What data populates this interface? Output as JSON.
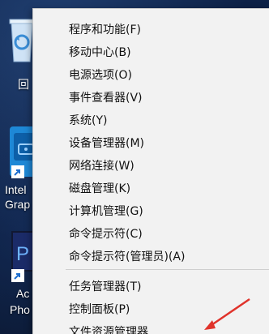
{
  "desktop": {
    "icons": [
      {
        "name": "recycle-bin",
        "label": "回"
      },
      {
        "name": "intel-graphics",
        "label_lines": [
          "Intel",
          "Grap"
        ]
      },
      {
        "name": "adobe-photoshop",
        "label_lines": [
          "Ac",
          "Pho"
        ]
      }
    ]
  },
  "context_menu": {
    "items": [
      {
        "id": "programs-features",
        "label": "程序和功能(F)"
      },
      {
        "id": "mobility-center",
        "label": "移动中心(B)"
      },
      {
        "id": "power-options",
        "label": "电源选项(O)"
      },
      {
        "id": "event-viewer",
        "label": "事件查看器(V)"
      },
      {
        "id": "system",
        "label": "系统(Y)"
      },
      {
        "id": "device-manager",
        "label": "设备管理器(M)"
      },
      {
        "id": "network-connections",
        "label": "网络连接(W)"
      },
      {
        "id": "disk-management",
        "label": "磁盘管理(K)"
      },
      {
        "id": "computer-management",
        "label": "计算机管理(G)"
      },
      {
        "id": "command-prompt",
        "label": "命令提示符(C)"
      },
      {
        "id": "command-prompt-admin",
        "label": "命令提示符(管理员)(A)"
      },
      {
        "id": "task-manager",
        "label": "任务管理器(T)"
      },
      {
        "id": "control-panel",
        "label": "控制面板(P)"
      },
      {
        "id": "file-explorer",
        "label": "文件资源管理器"
      }
    ]
  },
  "annotation": {
    "color": "#e0332b"
  }
}
